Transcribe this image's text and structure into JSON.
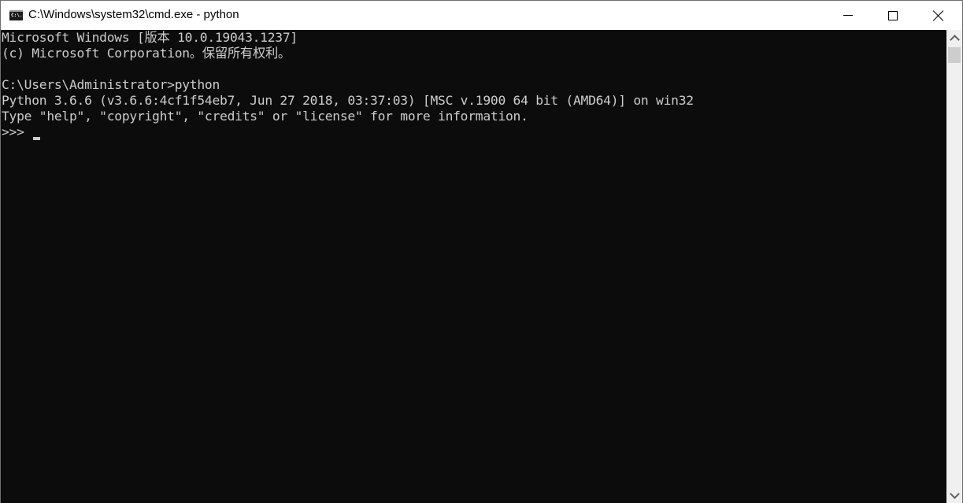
{
  "window": {
    "title": "C:\\Windows\\system32\\cmd.exe - python",
    "app_icon_text": "C:\\."
  },
  "console": {
    "lines": [
      "Microsoft Windows [版本 10.0.19043.1237]",
      "(c) Microsoft Corporation。保留所有权利。",
      "",
      "C:\\Users\\Administrator>python",
      "Python 3.6.6 (v3.6.6:4cf1f54eb7, Jun 27 2018, 03:37:03) [MSC v.1900 64 bit (AMD64)] on win32",
      "Type \"help\", \"copyright\", \"credits\" or \"license\" for more information.",
      ">>> "
    ],
    "colors": {
      "background": "#0c0c0c",
      "foreground": "#cccccc"
    }
  }
}
